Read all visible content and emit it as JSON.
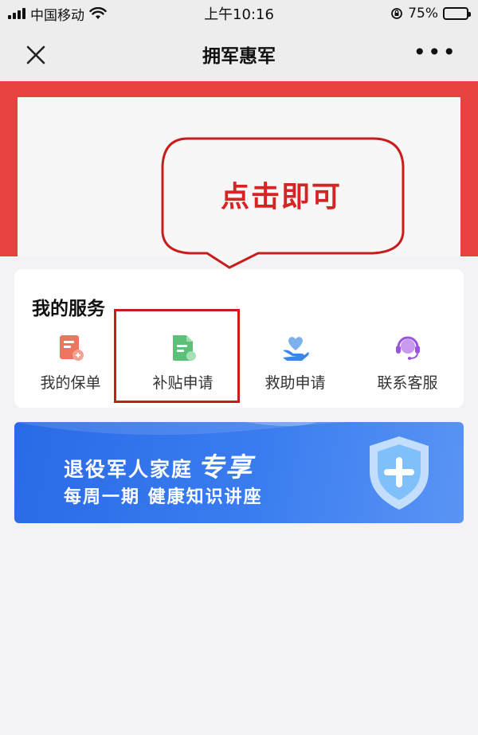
{
  "status_bar": {
    "carrier": "中国移动",
    "time": "上午10:16",
    "battery": "75%",
    "battery_level": 0.75
  },
  "nav": {
    "title": "拥军惠军",
    "more": "•••"
  },
  "callout": {
    "text": "点击即可"
  },
  "services": {
    "title": "我的服务",
    "items": [
      {
        "label": "我的保单",
        "icon": "policy-document-icon"
      },
      {
        "label": "补贴申请",
        "icon": "subsidy-document-icon"
      },
      {
        "label": "救助申请",
        "icon": "heart-hand-icon"
      },
      {
        "label": "联系客服",
        "icon": "headset-icon"
      }
    ]
  },
  "promo": {
    "line1": "退役军人家庭",
    "line1_emphasis": "专享",
    "line2": "每周一期 健康知识讲座"
  },
  "colors": {
    "banner_red": "#e6423f",
    "highlight_red": "#c81d1d",
    "promo_blue": "#2a6ae6"
  }
}
